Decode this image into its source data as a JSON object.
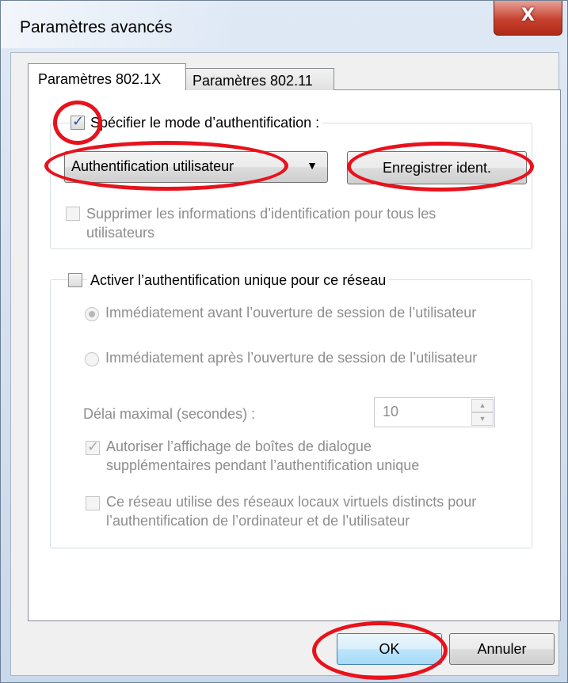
{
  "window": {
    "title": "Paramètres avancés",
    "close_glyph": "X"
  },
  "tabs": [
    {
      "label": "Paramètres 802.1X",
      "active": true
    },
    {
      "label": "Paramètres 802.11",
      "active": false
    }
  ],
  "auth_group": {
    "specify_mode_label": "Spécifier le mode d’authentification :",
    "specify_mode_checked": true,
    "mode_select_value": "Authentification utilisateur",
    "save_credentials_button": "Enregistrer ident.",
    "delete_credentials_label": "Supprimer les informations d’identification pour tous les utilisateurs",
    "delete_credentials_checked": false
  },
  "sso_group": {
    "enable_sso_label": "Activer l’authentification unique pour ce réseau",
    "enable_sso_checked": false,
    "radio_before_label": "Immédiatement avant l’ouverture de session de l’utilisateur",
    "radio_before_selected": true,
    "radio_after_label": "Immédiatement après l’ouverture de session de l’utilisateur",
    "radio_after_selected": false,
    "max_delay_label": "Délai maximal (secondes) :",
    "max_delay_value": "10",
    "allow_dialogs_label": "Autoriser l’affichage de boîtes de dialogue supplémentaires pendant l’authentification unique",
    "allow_dialogs_checked": true,
    "separate_vlans_label": "Ce réseau utilise des réseaux locaux virtuels distincts pour l’authentification de l’ordinateur et de l’utilisateur",
    "separate_vlans_checked": false
  },
  "footer": {
    "ok_label": "OK",
    "cancel_label": "Annuler"
  },
  "colors": {
    "annotation": "#e8121c",
    "close_button": "#c7412f",
    "disabled_text": "#8d8d8d"
  },
  "icons": {
    "close": "close-icon",
    "dropdown": "chevron-down-icon",
    "spin_up": "spin-up-icon",
    "spin_down": "spin-down-icon",
    "checkmark": "checkmark-icon"
  }
}
